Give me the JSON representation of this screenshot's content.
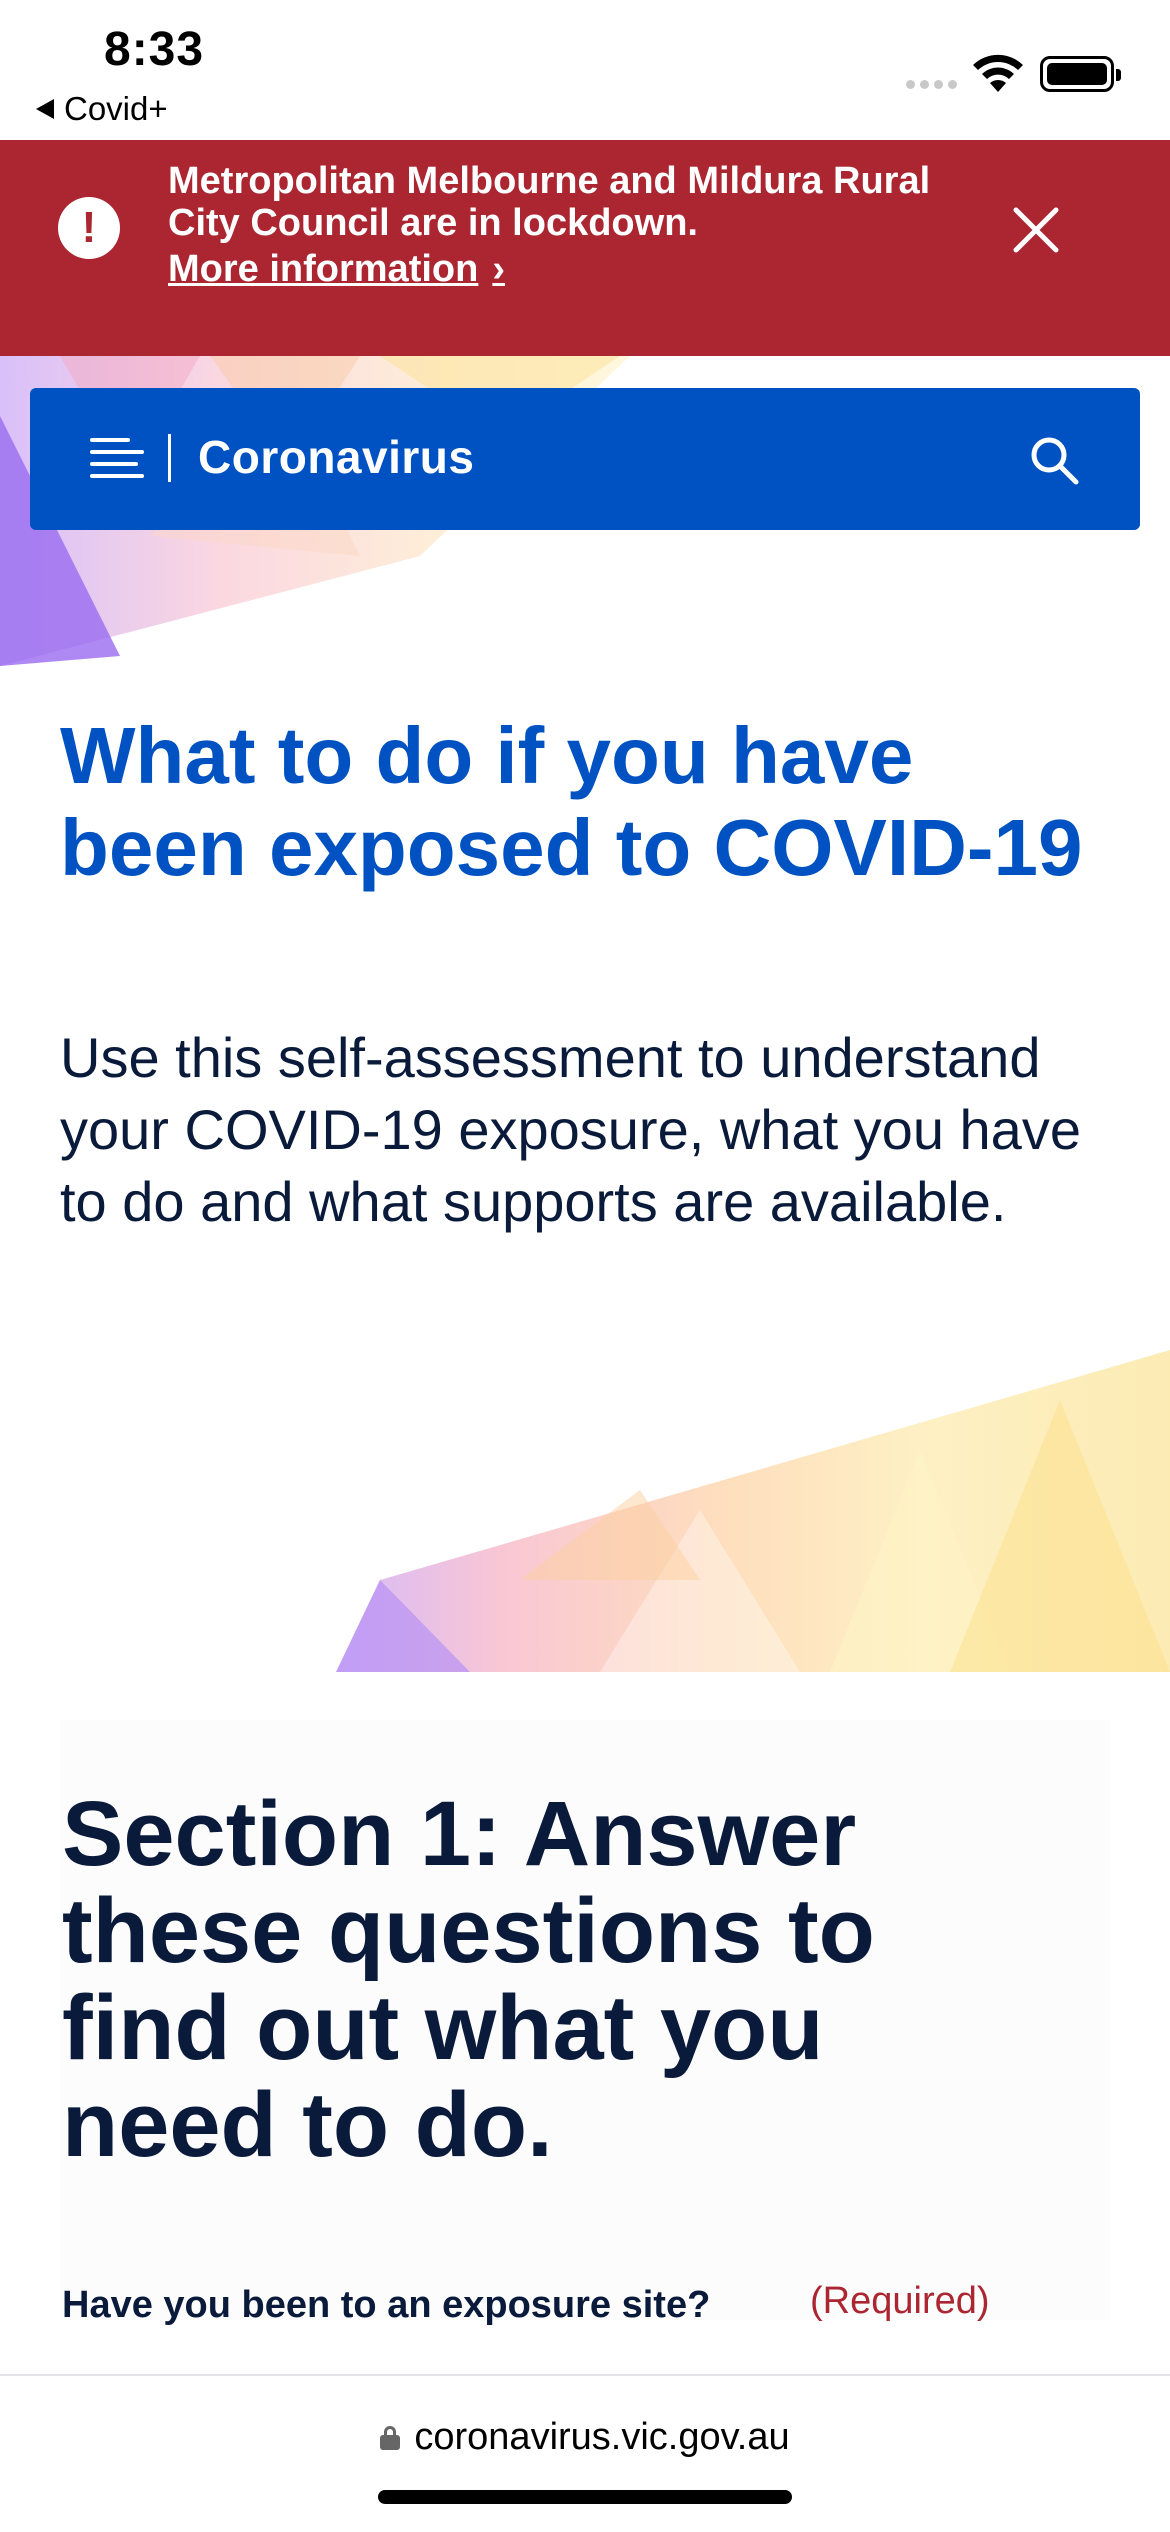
{
  "status_bar": {
    "time": "8:33",
    "back_app": "Covid+"
  },
  "alert": {
    "message": "Metropolitan Melbourne and Mildura Rural City Council are in lockdown.",
    "link_label": "More information",
    "link_chevron": "›",
    "icon": "exclamation-icon",
    "color": "#ab2631"
  },
  "nav": {
    "title": "Coronavirus",
    "color": "#0052c2"
  },
  "main": {
    "title": "What to do if you have been exposed to COVID-19",
    "intro": "Use this self-assessment to understand your COVID-19 exposure, what you have to do and what supports are available."
  },
  "section1": {
    "heading": "Section 1: Answer these questions to find out what you need to do.",
    "question": "Have you been to an exposure site?",
    "required_label": "(Required)"
  },
  "browser": {
    "url": "coronavirus.vic.gov.au"
  }
}
